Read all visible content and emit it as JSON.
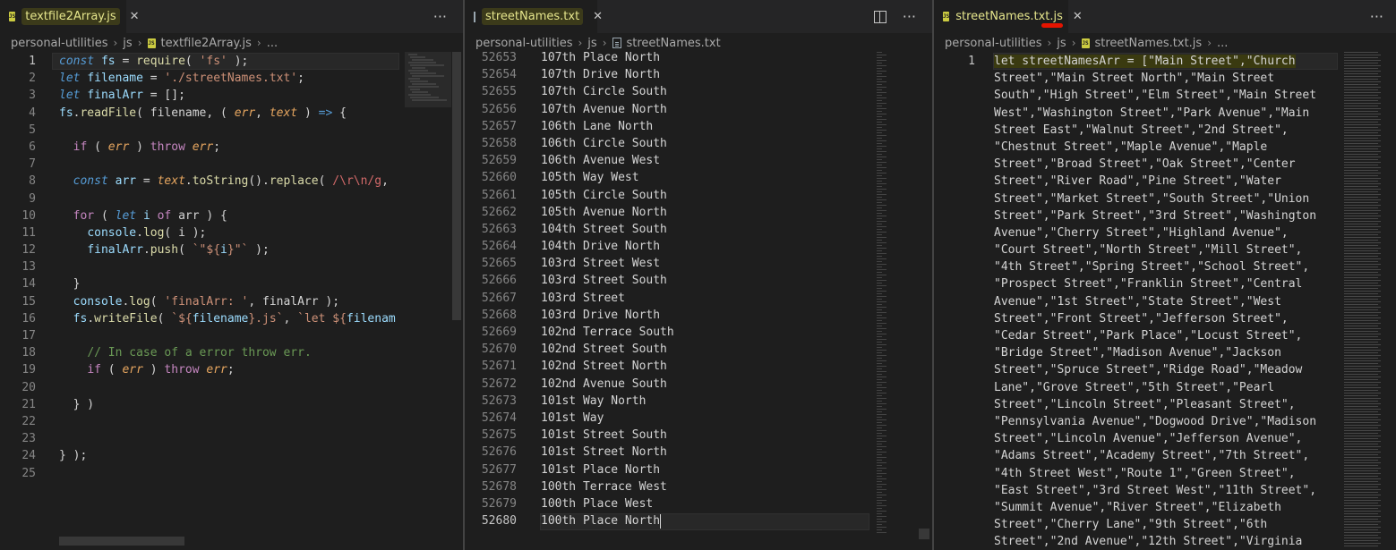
{
  "panes": [
    {
      "tab": {
        "file_name": "textfile2Array.js",
        "close": "✕"
      },
      "breadcrumb": [
        "personal-utilities",
        "js",
        "textfile2Array.js",
        "..."
      ],
      "more": "···"
    },
    {
      "tab": {
        "file_name": "streetNames.txt",
        "close": "✕"
      },
      "breadcrumb": [
        "personal-utilities",
        "js",
        "streetNames.txt"
      ],
      "more": "···",
      "split": "▯▯"
    },
    {
      "tab": {
        "file_name": "streetNames.txt.js",
        "close": "✕"
      },
      "breadcrumb": [
        "personal-utilities",
        "js",
        "streetNames.txt.js",
        "..."
      ],
      "more": "···"
    }
  ],
  "pane1_line_numbers": [
    "1",
    "2",
    "3",
    "4",
    "5",
    "6",
    "7",
    "8",
    "9",
    "10",
    "11",
    "12",
    "13",
    "14",
    "15",
    "16",
    "17",
    "18",
    "19",
    "20",
    "21",
    "22",
    "23",
    "24",
    "25"
  ],
  "pane1_code": [
    [
      [
        "kw",
        "const "
      ],
      [
        "var",
        "fs"
      ],
      [
        "pl",
        " = "
      ],
      [
        "fn",
        "require"
      ],
      [
        "pl",
        "( "
      ],
      [
        "str",
        "'fs'"
      ],
      [
        "pl",
        " );"
      ]
    ],
    [
      [
        "kw",
        "let "
      ],
      [
        "var",
        "filename"
      ],
      [
        "pl",
        " = "
      ],
      [
        "str",
        "'./streetNames.txt'"
      ],
      [
        "pl",
        ";"
      ]
    ],
    [
      [
        "kw",
        "let "
      ],
      [
        "var",
        "finalArr"
      ],
      [
        "pl",
        " = [];"
      ]
    ],
    [
      [
        "var",
        "fs"
      ],
      [
        "pl",
        "."
      ],
      [
        "fn",
        "readFile"
      ],
      [
        "pl",
        "( filename, ( "
      ],
      [
        "param",
        "err"
      ],
      [
        "pl",
        ", "
      ],
      [
        "param",
        "text"
      ],
      [
        "pl",
        " ) "
      ],
      [
        "kw",
        "=>"
      ],
      [
        "pl",
        " {"
      ]
    ],
    [],
    [
      [
        "pl",
        "  "
      ],
      [
        "kw2",
        "if"
      ],
      [
        "pl",
        " ( "
      ],
      [
        "param",
        "err"
      ],
      [
        "pl",
        " ) "
      ],
      [
        "kw2",
        "throw"
      ],
      [
        "pl",
        " "
      ],
      [
        "param",
        "err"
      ],
      [
        "pl",
        ";"
      ]
    ],
    [],
    [
      [
        "pl",
        "  "
      ],
      [
        "kw",
        "const "
      ],
      [
        "var",
        "arr"
      ],
      [
        "pl",
        " = "
      ],
      [
        "param",
        "text"
      ],
      [
        "pl",
        "."
      ],
      [
        "fn",
        "toString"
      ],
      [
        "pl",
        "()."
      ],
      [
        "fn",
        "replace"
      ],
      [
        "pl",
        "( "
      ],
      [
        "ctl",
        "/\\r\\n/g"
      ],
      [
        "pl",
        ","
      ]
    ],
    [],
    [
      [
        "pl",
        "  "
      ],
      [
        "kw2",
        "for"
      ],
      [
        "pl",
        " ( "
      ],
      [
        "kw",
        "let "
      ],
      [
        "var",
        "i"
      ],
      [
        "pl",
        " "
      ],
      [
        "kw2",
        "of"
      ],
      [
        "pl",
        " arr ) {"
      ]
    ],
    [
      [
        "pl",
        "    "
      ],
      [
        "var",
        "console"
      ],
      [
        "pl",
        "."
      ],
      [
        "fn",
        "log"
      ],
      [
        "pl",
        "( i );"
      ]
    ],
    [
      [
        "pl",
        "    "
      ],
      [
        "var",
        "finalArr"
      ],
      [
        "pl",
        "."
      ],
      [
        "fn",
        "push"
      ],
      [
        "pl",
        "( "
      ],
      [
        "str",
        "`\"${"
      ],
      [
        "var",
        "i"
      ],
      [
        "str",
        "}\"`"
      ],
      [
        "pl",
        " );"
      ]
    ],
    [],
    [
      [
        "pl",
        "  }"
      ]
    ],
    [
      [
        "pl",
        "  "
      ],
      [
        "var",
        "console"
      ],
      [
        "pl",
        "."
      ],
      [
        "fn",
        "log"
      ],
      [
        "pl",
        "( "
      ],
      [
        "str",
        "'finalArr: '"
      ],
      [
        "pl",
        ", finalArr );"
      ]
    ],
    [
      [
        "pl",
        "  "
      ],
      [
        "var",
        "fs"
      ],
      [
        "pl",
        "."
      ],
      [
        "fn",
        "writeFile"
      ],
      [
        "pl",
        "( "
      ],
      [
        "str",
        "`${"
      ],
      [
        "var",
        "filename"
      ],
      [
        "str",
        "}.js`"
      ],
      [
        "pl",
        ", "
      ],
      [
        "str",
        "`let ${"
      ],
      [
        "var",
        "filenam"
      ]
    ],
    [],
    [
      [
        "pl",
        "    "
      ],
      [
        "cmt",
        "// In case of a error throw err."
      ]
    ],
    [
      [
        "pl",
        "    "
      ],
      [
        "kw2",
        "if"
      ],
      [
        "pl",
        " ( "
      ],
      [
        "param",
        "err"
      ],
      [
        "pl",
        " ) "
      ],
      [
        "kw2",
        "throw"
      ],
      [
        "pl",
        " "
      ],
      [
        "param",
        "err"
      ],
      [
        "pl",
        ";"
      ]
    ],
    [],
    [
      [
        "pl",
        "  } )"
      ]
    ],
    [],
    [],
    [
      [
        "pl",
        "} );"
      ]
    ],
    []
  ],
  "pane2_lines": [
    {
      "n": "52653",
      "t": "107th Place North"
    },
    {
      "n": "52654",
      "t": "107th Drive North"
    },
    {
      "n": "52655",
      "t": "107th Circle South"
    },
    {
      "n": "52656",
      "t": "107th Avenue North"
    },
    {
      "n": "52657",
      "t": "106th Lane North"
    },
    {
      "n": "52658",
      "t": "106th Circle South"
    },
    {
      "n": "52659",
      "t": "106th Avenue West"
    },
    {
      "n": "52660",
      "t": "105th Way West"
    },
    {
      "n": "52661",
      "t": "105th Circle South"
    },
    {
      "n": "52662",
      "t": "105th Avenue North"
    },
    {
      "n": "52663",
      "t": "104th Street South"
    },
    {
      "n": "52664",
      "t": "104th Drive North"
    },
    {
      "n": "52665",
      "t": "103rd Street West"
    },
    {
      "n": "52666",
      "t": "103rd Street South"
    },
    {
      "n": "52667",
      "t": "103rd Street"
    },
    {
      "n": "52668",
      "t": "103rd Drive North"
    },
    {
      "n": "52669",
      "t": "102nd Terrace South"
    },
    {
      "n": "52670",
      "t": "102nd Street South"
    },
    {
      "n": "52671",
      "t": "102nd Street North"
    },
    {
      "n": "52672",
      "t": "102nd Avenue South"
    },
    {
      "n": "52673",
      "t": "101st Way North"
    },
    {
      "n": "52674",
      "t": "101st Way"
    },
    {
      "n": "52675",
      "t": "101st Street South"
    },
    {
      "n": "52676",
      "t": "101st Street North"
    },
    {
      "n": "52677",
      "t": "101st Place North"
    },
    {
      "n": "52678",
      "t": "100th Terrace West"
    },
    {
      "n": "52679",
      "t": "100th Place West"
    },
    {
      "n": "52680",
      "t": "100th Place North"
    }
  ],
  "pane3_line_number": "1",
  "pane3_lines": [
    "let streetNamesArr = [\"Main Street\",\"Church",
    "Street\",\"Main Street North\",\"Main Street",
    "South\",\"High Street\",\"Elm Street\",\"Main Street",
    "West\",\"Washington Street\",\"Park Avenue\",\"Main",
    "Street East\",\"Walnut Street\",\"2nd Street\",",
    "\"Chestnut Street\",\"Maple Avenue\",\"Maple",
    "Street\",\"Broad Street\",\"Oak Street\",\"Center",
    "Street\",\"River Road\",\"Pine Street\",\"Water",
    "Street\",\"Market Street\",\"South Street\",\"Union",
    "Street\",\"Park Street\",\"3rd Street\",\"Washington",
    "Avenue\",\"Cherry Street\",\"Highland Avenue\",",
    "\"Court Street\",\"North Street\",\"Mill Street\",",
    "\"4th Street\",\"Spring Street\",\"School Street\",",
    "\"Prospect Street\",\"Franklin Street\",\"Central",
    "Avenue\",\"1st Street\",\"State Street\",\"West",
    "Street\",\"Front Street\",\"Jefferson Street\",",
    "\"Cedar Street\",\"Park Place\",\"Locust Street\",",
    "\"Bridge Street\",\"Madison Avenue\",\"Jackson",
    "Street\",\"Spruce Street\",\"Ridge Road\",\"Meadow",
    "Lane\",\"Grove Street\",\"5th Street\",\"Pearl",
    "Street\",\"Lincoln Street\",\"Pleasant Street\",",
    "\"Pennsylvania Avenue\",\"Dogwood Drive\",\"Madison",
    "Street\",\"Lincoln Avenue\",\"Jefferson Avenue\",",
    "\"Adams Street\",\"Academy Street\",\"7th Street\",",
    "\"4th Street West\",\"Route 1\",\"Green Street\",",
    "\"East Street\",\"3rd Street West\",\"11th Street\",",
    "\"Summit Avenue\",\"River Street\",\"Elizabeth",
    "Street\",\"Cherry Lane\",\"9th Street\",\"6th",
    "Street\",\"2nd Avenue\",\"12th Street\",\"Virginia"
  ]
}
